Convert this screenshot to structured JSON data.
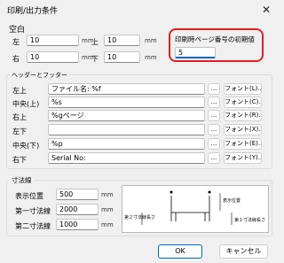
{
  "window": {
    "title": "印刷/出力条件",
    "close_glyph": "✕"
  },
  "margins": {
    "heading": "空白",
    "left_label": "左",
    "left_value": "10",
    "top_label": "上",
    "top_value": "10",
    "right_label": "右",
    "right_value": "10",
    "bottom_label": "下",
    "bottom_value": "10",
    "unit": "mm"
  },
  "start_page": {
    "label": "印刷時ページ番号の初期値",
    "value": "5"
  },
  "header_footer": {
    "heading": "ヘッダーとフッター",
    "browse_label": "...",
    "rows": [
      {
        "label": "左上",
        "value": "ファイル名: %f",
        "font_button": "フォント(L)..."
      },
      {
        "label": "中央(上)",
        "value": "%s",
        "font_button": "フォント(C)..."
      },
      {
        "label": "右上",
        "value": "%gページ",
        "font_button": "フォント(R)..."
      },
      {
        "label": "左下",
        "value": "",
        "font_button": "フォント(X)..."
      },
      {
        "label": "中央(下)",
        "value": "%p",
        "font_button": "フォント(E)..."
      },
      {
        "label": "右下",
        "value": "Serial No:",
        "font_button": "フォント(Y)..."
      }
    ]
  },
  "dimension_lines": {
    "heading": "寸法線",
    "unit": "mm",
    "rows": [
      {
        "label": "表示位置",
        "value": "500"
      },
      {
        "label": "第一寸法線",
        "value": "2000"
      },
      {
        "label": "第二寸法線",
        "value": "1000"
      }
    ],
    "diagram": {
      "display_position_label": "表示位置",
      "second_line_label": "第２寸法線長さ",
      "first_line_label": "第１寸法線長さ"
    }
  },
  "buttons": {
    "ok": "OK",
    "cancel": "キャンセル"
  }
}
